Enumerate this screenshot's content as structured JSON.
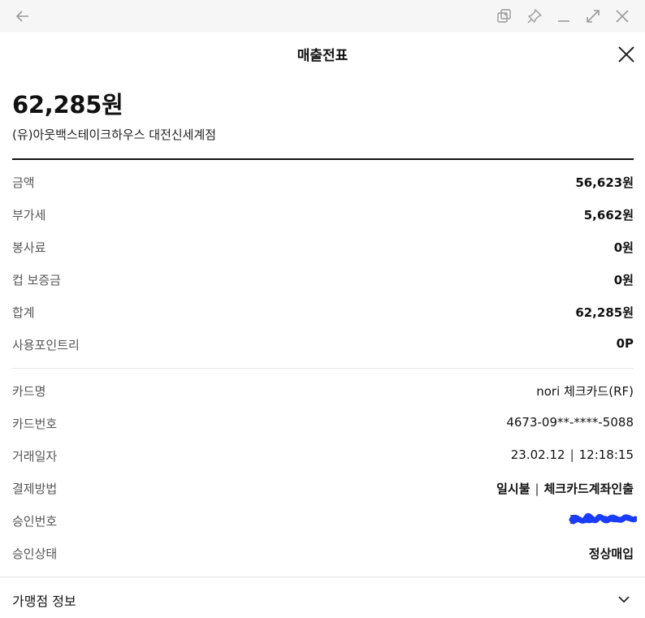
{
  "window": {
    "icons": [
      "back-arrow-icon",
      "duplicate-icon",
      "pin-icon",
      "minimize-icon",
      "maximize-icon",
      "close-icon"
    ]
  },
  "header": {
    "title": "매출전표"
  },
  "summary": {
    "total": "62,285원",
    "store": "(유)아웃백스테이크하우스 대전신세계점"
  },
  "amounts": [
    {
      "label": "금액",
      "value": "56,623원"
    },
    {
      "label": "부가세",
      "value": "5,662원"
    },
    {
      "label": "봉사료",
      "value": "0원"
    },
    {
      "label": "컵 보증금",
      "value": "0원"
    },
    {
      "label": "합계",
      "value": "62,285원"
    },
    {
      "label": "사용포인트리",
      "value": "0P"
    }
  ],
  "card": {
    "name": {
      "label": "카드명",
      "value": "nori 체크카드(RF)"
    },
    "number": {
      "label": "카드번호",
      "value": "4673-09**-****-5088"
    },
    "date": {
      "label": "거래일자",
      "date": "23.02.12",
      "sep": "|",
      "time": "12:18:15"
    },
    "method": {
      "label": "결제방법",
      "part1": "일시불",
      "sep": "|",
      "part2": "체크카드계좌인출"
    },
    "approval": {
      "label": "승인번호",
      "prefix": "3",
      "redaction_color": "#1a3cff"
    },
    "status": {
      "label": "승인상태",
      "value": "정상매입"
    }
  },
  "footer": {
    "label": "가맹점 정보"
  }
}
